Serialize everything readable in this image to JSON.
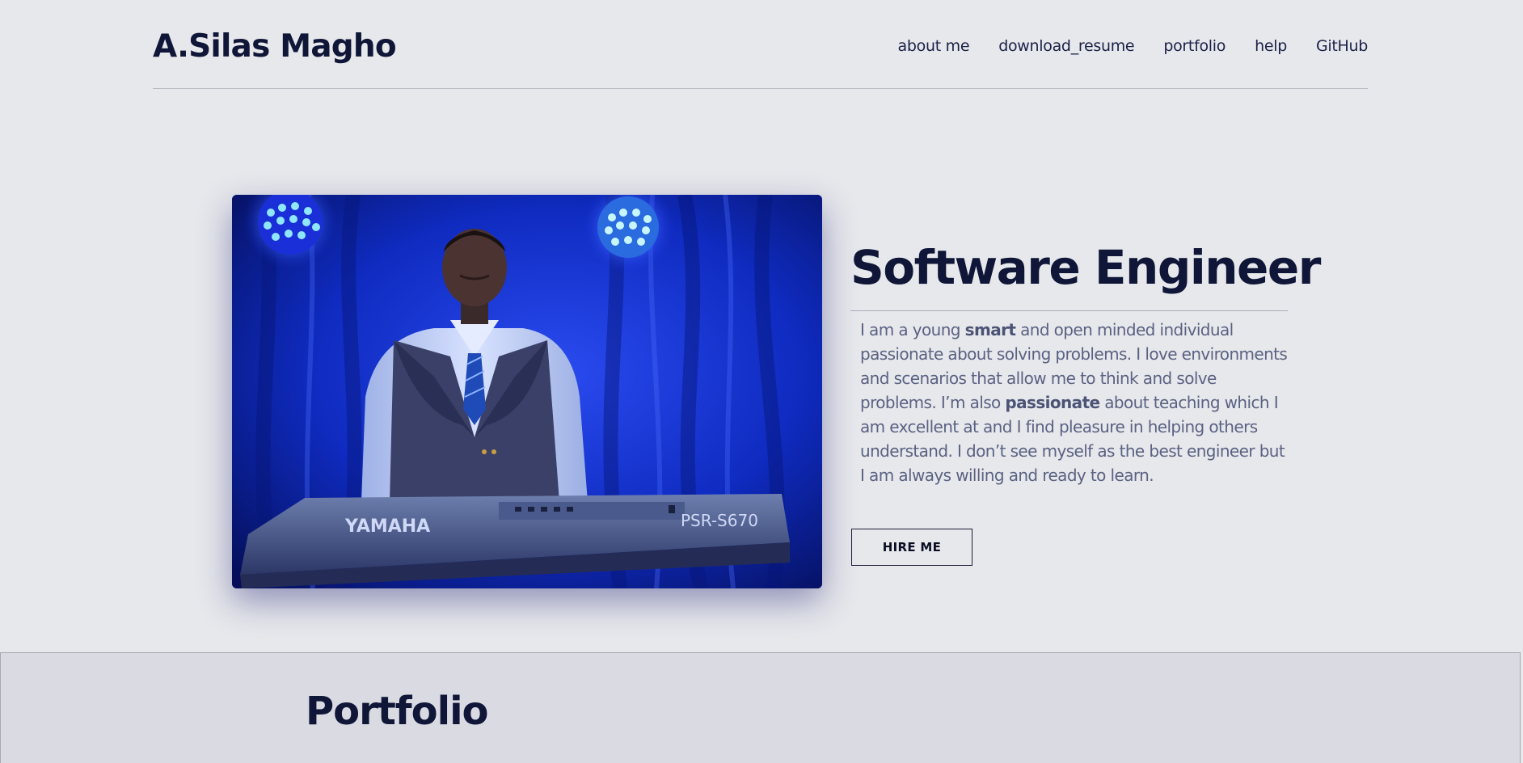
{
  "header": {
    "logo": "A.Silas Magho",
    "nav": [
      {
        "label": "about me"
      },
      {
        "label": "download_resume"
      },
      {
        "label": "portfolio"
      },
      {
        "label": "help"
      },
      {
        "label": "GitHub"
      }
    ]
  },
  "hero": {
    "photo_icon": "portrait-photo",
    "keyboard_brand": "YAMAHA",
    "keyboard_model": "PSR-S670",
    "title": "Software Engineer",
    "bio": [
      {
        "text": "I am a young ",
        "bold": false
      },
      {
        "text": "smart",
        "bold": true
      },
      {
        "text": " and open minded individual passionate about solving problems. I love environments and scenarios that allow me to think and solve problems. I’m also ",
        "bold": false
      },
      {
        "text": "passionate",
        "bold": true
      },
      {
        "text": " about teaching which I am excellent at and I find pleasure in helping others understand. I don’t see myself as the best engineer but I am always willing and ready to learn.",
        "bold": false
      }
    ],
    "cta_label": "HIRE ME"
  },
  "portfolio": {
    "title": "Portfolio"
  },
  "colors": {
    "background": "#e7e8ec",
    "section_background": "#d9dae2",
    "heading": "#0f1637",
    "body_text": "#5a6282",
    "stage_blue": "#0a1f9a"
  }
}
